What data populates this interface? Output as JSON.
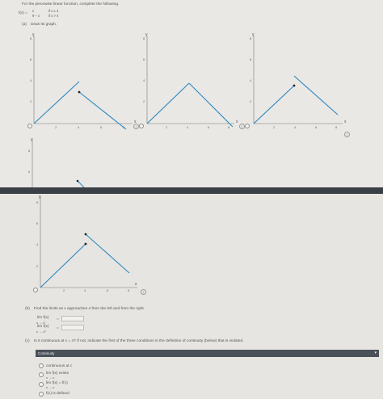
{
  "header": {
    "instruction": "For the piecewise linear function, complete the following.",
    "fx_label": "f(x) =",
    "piece1_expr": "x",
    "piece1_cond": "if x ≤ 4",
    "piece2_expr": "9 − x",
    "piece2_cond": "if x > 4"
  },
  "part_a": {
    "label": "(a)",
    "prompt": "Draw its graph."
  },
  "graphs": {
    "axis_x_label": "x",
    "axis_y_label": "y",
    "x_ticks": [
      "2",
      "4",
      "6",
      "8"
    ],
    "y_ticks": [
      "2",
      "4",
      "6",
      "8"
    ]
  },
  "part_b": {
    "label": "(b)",
    "prompt": "Find the limits as x approaches 4 from the left and from the right.",
    "lim_left": "lim f(x)",
    "lim_left_sub": "x → 4⁻",
    "lim_right": "lim f(x)",
    "lim_right_sub": "x → 4⁺",
    "equals": "=",
    "left_value": "",
    "right_value": ""
  },
  "part_c": {
    "label": "(c)",
    "prompt": "Is it continuous at x = 4? If not, indicate the first of the three conditions in the definition of continuity (below) that is violated.",
    "dropdown_title": "Continuity",
    "options": [
      {
        "main": "continuous at c",
        "sub": ""
      },
      {
        "main": "lim f(x) exists",
        "sub": "x → c"
      },
      {
        "main": "lim f(x) = f(c)",
        "sub": "x → c"
      },
      {
        "main": "f(c) is defined",
        "sub": ""
      }
    ]
  },
  "colors": {
    "line": "#2e86c1",
    "dark_bar": "#4a5058",
    "divider": "#3b3f46"
  }
}
